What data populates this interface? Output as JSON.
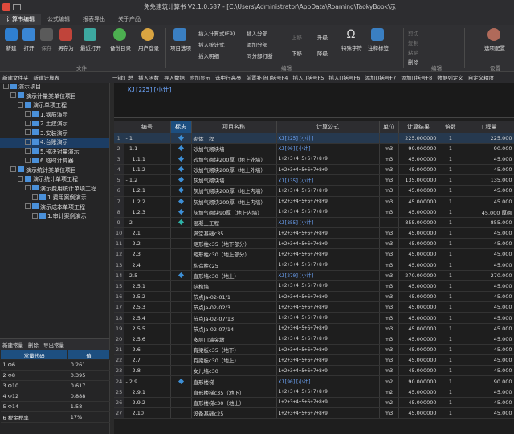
{
  "app": {
    "title": "免免建筑计算书 V2.1.0.587 - [C:\\Users\\Administrator\\AppData\\Roaming\\TaokyBook\\示"
  },
  "tabs": [
    "计算书编辑",
    "公式编辑",
    "报表导出",
    "关于产品"
  ],
  "ribbon": {
    "file": {
      "label": "文件",
      "buttons": [
        "新建",
        "打开",
        "保存",
        "另存为",
        "最近打开",
        "备份目录",
        "用户登录"
      ]
    },
    "project_btn": "项目选项",
    "insert": [
      "插入计算式(F9)",
      "插入统计式",
      "插入明细",
      "插入分部",
      "添加分部",
      "同分部打断"
    ],
    "edit": {
      "label": "编辑",
      "items": [
        "上移",
        "下移",
        "升级",
        "降级",
        "特殊字符",
        "注释标签"
      ]
    },
    "clip": [
      "剪切",
      "复制",
      "粘贴",
      "删除"
    ],
    "edit_label2": "编辑",
    "settings_btn": "选项配置",
    "settings_label": "设置"
  },
  "left_toolbar": [
    "新建文件夹",
    "新建计算表"
  ],
  "right_toolbar": [
    "一键汇总",
    "插入函数",
    "导入数据",
    "附加显示",
    "选中行高亮",
    "前置补充()括号F4",
    "插入()括号F5",
    "插入[]括号F6",
    "添加()括号F7",
    "添加[]括号F8",
    "数据列定义",
    "自定义精度"
  ],
  "tree": [
    {
      "label": "演示项目",
      "level": 0
    },
    {
      "label": "演示计量类单位项目",
      "level": 1
    },
    {
      "label": "演示单项工程",
      "level": 2
    },
    {
      "label": "1.钢筋演示",
      "level": 3
    },
    {
      "label": "2.土建演示",
      "level": 3
    },
    {
      "label": "3.安装演示",
      "level": 3
    },
    {
      "label": "4.台账演示",
      "level": 3,
      "selected": true
    },
    {
      "label": "5.预决对量演示",
      "level": 3
    },
    {
      "label": "6.临时计算器",
      "level": 3
    },
    {
      "label": "演示统计类单位项目",
      "level": 1
    },
    {
      "label": "演示统计单项工程",
      "level": 2
    },
    {
      "label": "演示费用统计单项工程",
      "level": 3
    },
    {
      "label": "1.费用案例演示",
      "level": 4
    },
    {
      "label": "演示成本单项工程",
      "level": 3
    },
    {
      "label": "1.审计案例演示",
      "level": 4
    }
  ],
  "constants": {
    "toolbar": [
      "新建常量",
      "删除",
      "导出常量"
    ],
    "headers": [
      "常量代码",
      "值"
    ],
    "rows": [
      [
        "1 Φ6",
        "0.261"
      ],
      [
        "2 Φ8",
        "0.395"
      ],
      [
        "3 Φ10",
        "0.617"
      ],
      [
        "4 Φ12",
        "0.888"
      ],
      [
        "5 Φ14",
        "1.58"
      ],
      [
        "6 税金税率",
        "17%"
      ]
    ]
  },
  "formula_bar": {
    "text": "XJ[225][小计]"
  },
  "grid": {
    "headers": [
      "",
      "编号",
      "标志",
      "项目名称",
      "计算公式",
      "单位",
      "计算结果",
      "倍数",
      "工程量"
    ],
    "rows": [
      [
        "1",
        "-  1",
        "b",
        "砌体工程",
        "XJ[225][小计]",
        "",
        "225.000000",
        "1",
        "225.000"
      ],
      [
        "2",
        "-  1.1",
        "b",
        "砂加气砌块墙",
        "XJ[90][小计]",
        "m3",
        "90.000000",
        "1",
        "90.000"
      ],
      [
        "3",
        "1.1.1",
        "b",
        "砂加气砌块200厚（地上外墙）",
        "1+2+3+4+5+6+7+8+9",
        "m3",
        "45.000000",
        "1",
        "45.000"
      ],
      [
        "4",
        "1.1.2",
        "b",
        "砂加气砌块200厚（地上外墙）",
        "1+2+3+4+5+6+7+8+9",
        "m3",
        "45.000000",
        "1",
        "45.000"
      ],
      [
        "5",
        "-  1.2",
        "b",
        "灰加气砌块墙",
        "XJ[135][小计]",
        "m3",
        "135.000000",
        "1",
        "135.000"
      ],
      [
        "6",
        "1.2.1",
        "b",
        "灰加气砌块200厚（地上内墙）",
        "1+2+3+4+5+6+7+8+9",
        "m3",
        "45.000000",
        "1",
        "45.000"
      ],
      [
        "7",
        "1.2.2",
        "b",
        "灰加气砌块200厚（地上内墙）",
        "1+2+3+4+5+6+7+8+9",
        "m3",
        "45.000000",
        "1",
        "45.000"
      ],
      [
        "8",
        "1.2.3",
        "b",
        "灰加气砌块90厚（地上内墙）",
        "1+2+3+4+5+6+7+8+9",
        "m3",
        "45.000000",
        "1",
        "45.000 厚砌"
      ],
      [
        "9",
        "-  2",
        "t",
        "混凝土工程",
        "XJ[855][小计]",
        "",
        "855.000000",
        "1",
        "855.000"
      ],
      [
        "10",
        "2.1",
        "",
        "满堂基础c35",
        "1+2+3+4+5+6+7+8+9",
        "m3",
        "45.000000",
        "1",
        "45.000"
      ],
      [
        "11",
        "2.2",
        "",
        "矩形柱c35（地下部分）",
        "1+2+3+4+5+6+7+8+9",
        "m3",
        "45.000000",
        "1",
        "45.000"
      ],
      [
        "12",
        "2.3",
        "",
        "矩形柱c30（地上部分）",
        "1+2+3+4+5+6+7+8+9",
        "m3",
        "45.000000",
        "1",
        "45.000"
      ],
      [
        "13",
        "2.4",
        "",
        "构造柱c25",
        "1+2+3+4+5+6+7+8+9",
        "m3",
        "45.000000",
        "1",
        "45.000"
      ],
      [
        "14",
        "-  2.5",
        "b",
        "直形墙c30（地上）",
        "XJ[270][小计]",
        "m3",
        "270.000000",
        "1",
        "270.000"
      ],
      [
        "15",
        "2.5.1",
        "",
        "结构墙",
        "1+2+3+4+5+6+7+8+9",
        "m3",
        "45.000000",
        "1",
        "45.000"
      ],
      [
        "16",
        "2.5.2",
        "",
        "节点Ja-02-01/1",
        "1+2+3+4+5+6+7+8+9",
        "m3",
        "45.000000",
        "1",
        "45.000"
      ],
      [
        "17",
        "2.5.3",
        "",
        "节点Ja-02-02/3",
        "1+2+3+4+5+6+7+8+9",
        "m3",
        "45.000000",
        "1",
        "45.000"
      ],
      [
        "18",
        "2.5.4",
        "",
        "节点Ja-02-07/13",
        "1+2+3+4+5+6+7+8+9",
        "m3",
        "45.000000",
        "1",
        "45.000"
      ],
      [
        "19",
        "2.5.5",
        "",
        "节点Ja-02-07/14",
        "1+2+3+4+5+6+7+8+9",
        "m3",
        "45.000000",
        "1",
        "45.000"
      ],
      [
        "20",
        "2.5.6",
        "",
        "多层山墙突墩",
        "1+2+3+4+5+6+7+8+9",
        "m3",
        "45.000000",
        "1",
        "45.000"
      ],
      [
        "21",
        "2.6",
        "",
        "有梁板c35（地下）",
        "1+2+3+4+5+6+7+8+9",
        "m3",
        "45.000000",
        "1",
        "45.000"
      ],
      [
        "22",
        "2.7",
        "",
        "有梁板c30（地上）",
        "1+2+3+4+5+6+7+8+9",
        "m3",
        "45.000000",
        "1",
        "45.000"
      ],
      [
        "23",
        "2.8",
        "",
        "女儿墙c30",
        "1+2+3+4+5+6+7+8+9",
        "m3",
        "45.000000",
        "1",
        "45.000"
      ],
      [
        "24",
        "-  2.9",
        "b",
        "直形楼梯",
        "XJ[90][小计]",
        "m2",
        "90.000000",
        "1",
        "90.000"
      ],
      [
        "25",
        "2.9.1",
        "",
        "直形楼梯c35（地下）",
        "1+2+3+4+5+6+7+8+9",
        "m2",
        "45.000000",
        "1",
        "45.000"
      ],
      [
        "26",
        "2.9.2",
        "",
        "直形楼梯c30（地上）",
        "1+2+3+4+5+6+7+8+9",
        "m2",
        "45.000000",
        "1",
        "45.000"
      ],
      [
        "27",
        "2.10",
        "",
        "设备基础c25",
        "1+2+3+4+5+6+7+8+9",
        "m3",
        "45.000000",
        "1",
        "45.000"
      ]
    ]
  }
}
